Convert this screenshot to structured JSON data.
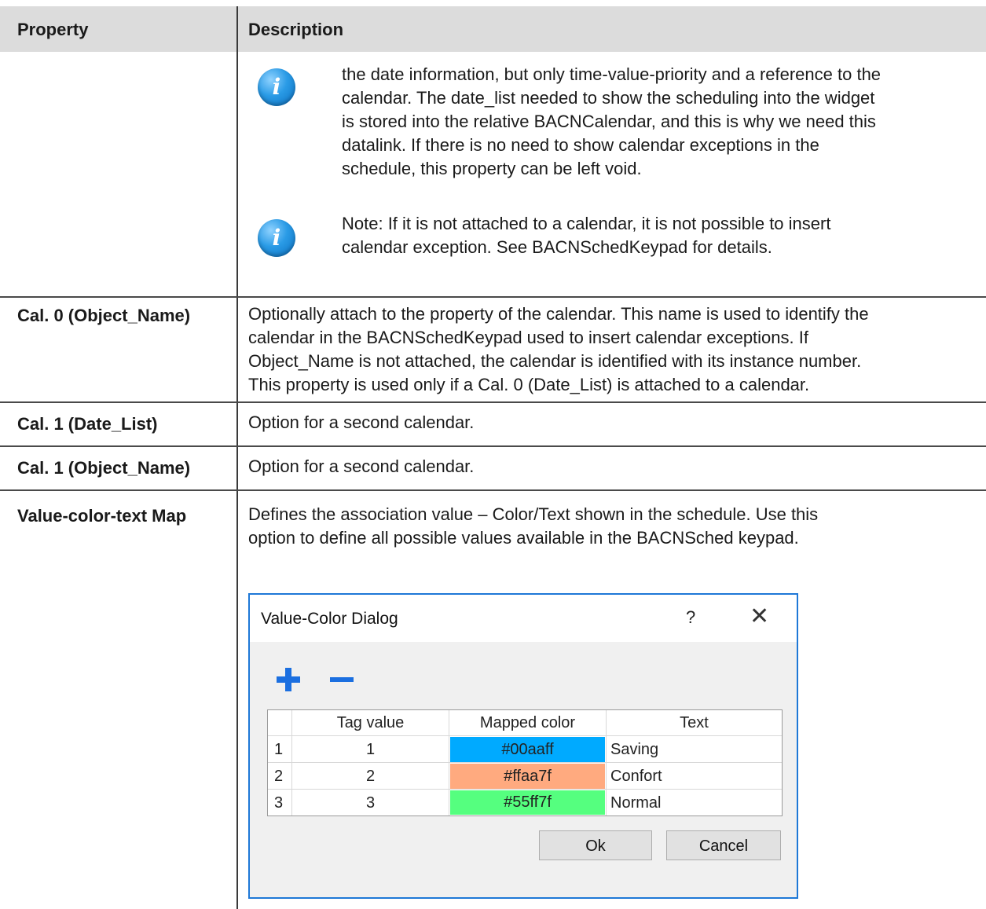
{
  "header": {
    "property": "Property",
    "description": "Description"
  },
  "notes": [
    {
      "icon": "info-icon",
      "lines": [
        "the date information, but only time-value-priority and a reference to the",
        "calendar. The date_list needed to show the scheduling into the widget",
        "is stored into the relative BACNCalendar, and this is why we need this",
        "datalink. If there is no need to show calendar exceptions in the",
        "schedule, this property can be left void."
      ]
    },
    {
      "icon": "info-icon",
      "lines": [
        "Note: If it is not attached to a calendar, it is not possible to insert",
        "calendar exception. See BACNSchedKeypad for details."
      ]
    }
  ],
  "rows": [
    {
      "property": "Cal. 0 (Object_Name)",
      "lines": [
        "Optionally attach to the property of the calendar. This name is used to identify the",
        "calendar in the BACNSchedKeypad used to insert calendar exceptions. If",
        "Object_Name is not attached, the calendar is identified with its instance number.",
        "This property is used only if a Cal. 0 (Date_List) is attached to a calendar."
      ]
    },
    {
      "property": "Cal. 1 (Date_List)",
      "lines": [
        "Option for a second calendar."
      ]
    },
    {
      "property": "Cal. 1 (Object_Name)",
      "lines": [
        "Option for a second calendar."
      ]
    },
    {
      "property": "Value-color-text Map",
      "lines": [
        "Defines the association value – Color/Text shown in the schedule. Use this",
        "option to define all possible values available in the BACNSched keypad."
      ]
    }
  ],
  "dialog": {
    "title": "Value-Color Dialog",
    "help": "?",
    "close": "✕",
    "add_icon": "plus-icon",
    "remove_icon": "minus-icon",
    "columns": [
      "Tag value",
      "Mapped color",
      "Text"
    ],
    "rows": [
      {
        "index": "1",
        "tag": "1",
        "color_label": "#00aaff",
        "color": "#00aaff",
        "text": "Saving"
      },
      {
        "index": "2",
        "tag": "2",
        "color_label": "#ffaa7f",
        "color": "#ffaa7f",
        "text": "Confort"
      },
      {
        "index": "3",
        "tag": "3",
        "color_label": "#55ff7f",
        "color": "#55ff7f",
        "text": "Normal"
      }
    ],
    "ok_label": "Ok",
    "cancel_label": "Cancel"
  }
}
